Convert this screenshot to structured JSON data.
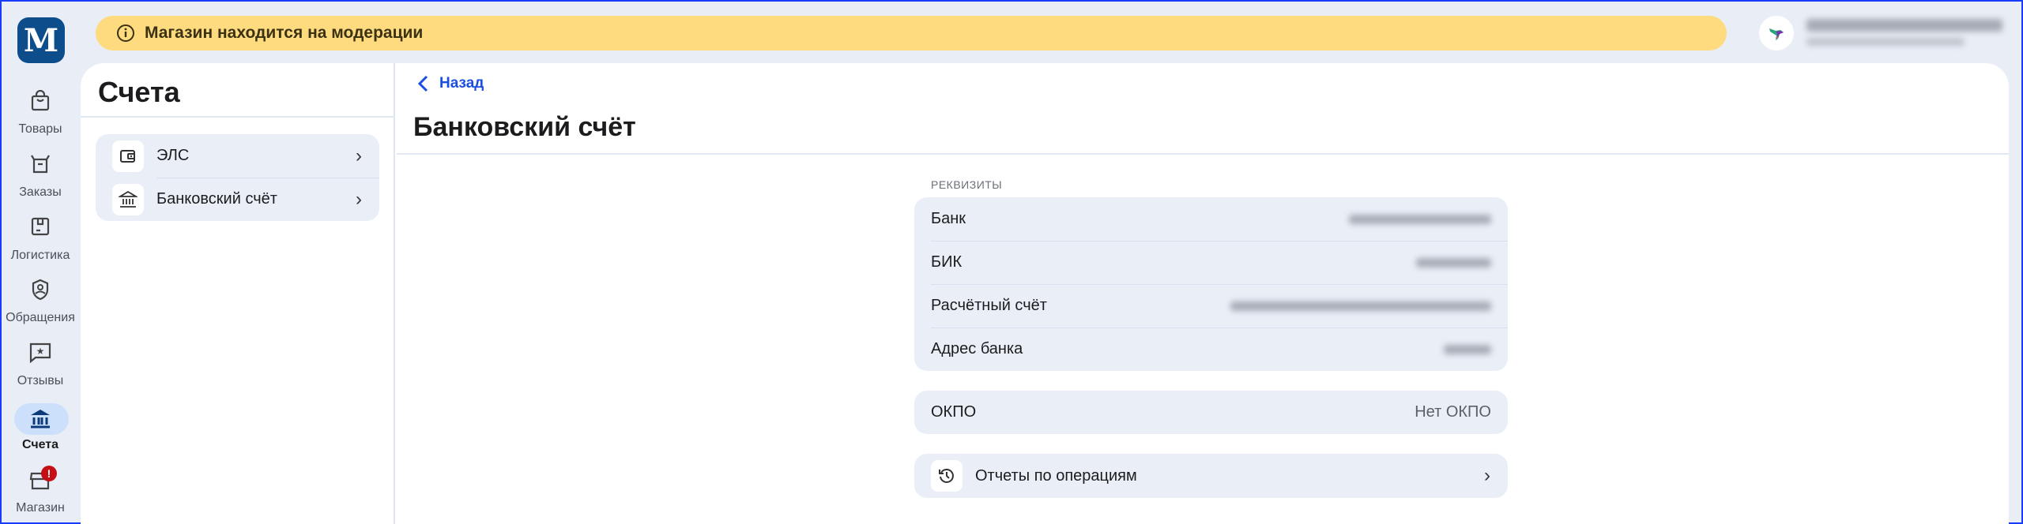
{
  "sidebar": {
    "items": [
      {
        "label": "Товары",
        "icon": "shopping-bag-icon"
      },
      {
        "label": "Заказы",
        "icon": "box-icon"
      },
      {
        "label": "Логистика",
        "icon": "package-icon"
      },
      {
        "label": "Обращения",
        "icon": "support-shield-icon"
      },
      {
        "label": "Отзывы",
        "icon": "star-message-icon"
      },
      {
        "label": "Счета",
        "icon": "bank-icon",
        "active": true
      },
      {
        "label": "Магазин",
        "icon": "store-icon",
        "badge": "!"
      }
    ]
  },
  "banner": {
    "text": "Магазин находится на модерации",
    "color": "#fedb7f"
  },
  "accounts": {
    "title": "Счета",
    "items": [
      {
        "label": "ЭЛС",
        "icon": "wallet-icon"
      },
      {
        "label": "Банковский счёт",
        "icon": "bank-icon"
      }
    ]
  },
  "detail": {
    "back_label": "Назад",
    "title": "Банковский счёт",
    "section_label": "РЕКВИЗИТЫ",
    "requisites": [
      {
        "label": "Банк"
      },
      {
        "label": "БИК"
      },
      {
        "label": "Расчётный счёт"
      },
      {
        "label": "Адрес банка"
      }
    ],
    "okpo": {
      "label": "ОКПО",
      "value": "Нет ОКПО"
    },
    "reports_label": "Отчеты по операциям"
  },
  "colors": {
    "accent": "#1a4fe0",
    "active_pill": "#cde0fb",
    "badge": "#c40f15"
  }
}
